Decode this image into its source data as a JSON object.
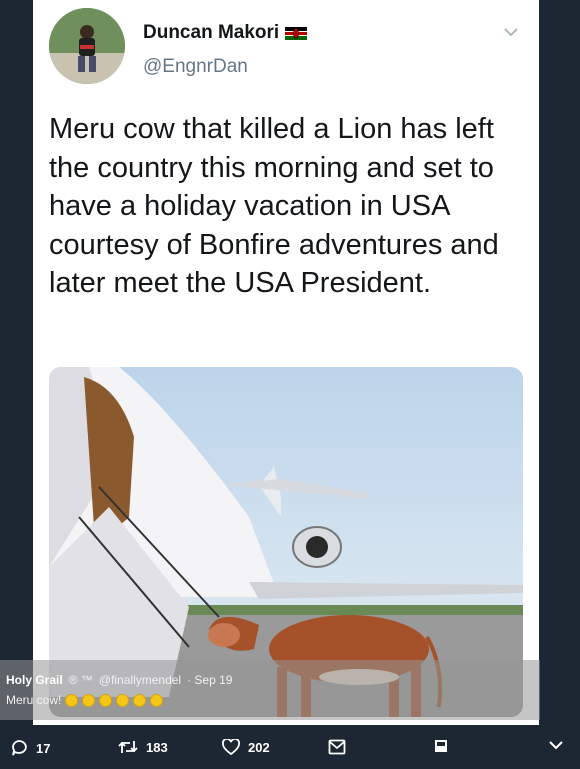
{
  "tweet": {
    "author_name": "Duncan Makori",
    "handle": "@EngnrDan",
    "text": "Meru cow that killed a Lion has left the country this morning and set to have a holiday vacation in USA courtesy of Bonfire adventures and later meet the USA President.",
    "flag_icon": "kenya-flag-icon"
  },
  "quote": {
    "name": "Holy Grail",
    "badges": "® ™",
    "handle": "@finallymendel",
    "date": "· Sep 19",
    "text": "Meru cow!",
    "emoji_icon": "laughing-emoji-icon",
    "emoji_count": 6
  },
  "actions": {
    "replies": "17",
    "retweets": "183",
    "likes": "202"
  },
  "colors": {
    "background": "#1c2733",
    "card": "#ffffff",
    "name": "#14171a",
    "handle": "#657786"
  }
}
